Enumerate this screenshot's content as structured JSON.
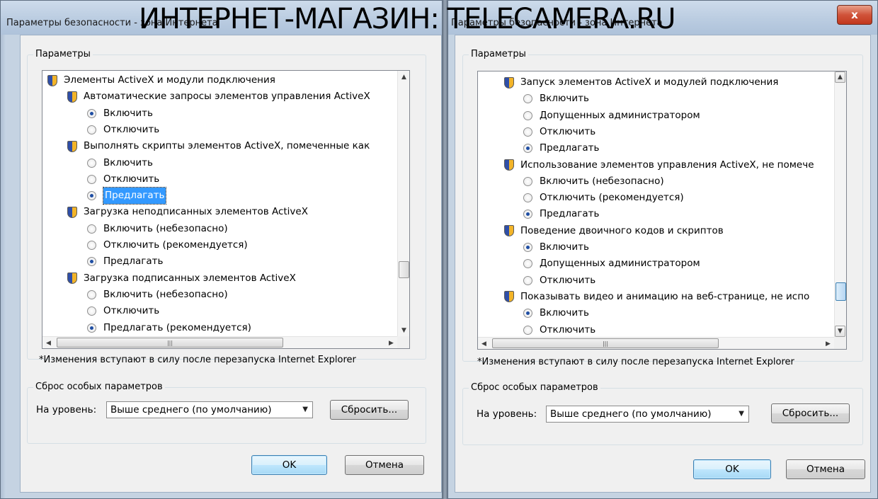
{
  "watermark": "ИНТЕРНЕТ-МАГАЗИН: TELECAMERA.RU",
  "left": {
    "title": "Параметры безопасности - зона Интернета",
    "group_params": "Параметры",
    "rows": [
      {
        "kind": "cat",
        "text": "Элементы ActiveX и модули подключения"
      },
      {
        "kind": "cat",
        "text": "Автоматические запросы элементов управления ActiveX"
      },
      {
        "kind": "radio",
        "on": true,
        "text": "Включить"
      },
      {
        "kind": "radio",
        "on": false,
        "text": "Отключить"
      },
      {
        "kind": "cat",
        "text": "Выполнять скрипты элементов ActiveX, помеченные как"
      },
      {
        "kind": "radio",
        "on": false,
        "text": "Включить"
      },
      {
        "kind": "radio",
        "on": false,
        "text": "Отключить"
      },
      {
        "kind": "radio",
        "on": true,
        "selected": true,
        "text": "Предлагать"
      },
      {
        "kind": "cat",
        "text": "Загрузка неподписанных элементов ActiveX"
      },
      {
        "kind": "radio",
        "on": false,
        "text": "Включить (небезопасно)"
      },
      {
        "kind": "radio",
        "on": false,
        "text": "Отключить (рекомендуется)"
      },
      {
        "kind": "radio",
        "on": true,
        "text": "Предлагать"
      },
      {
        "kind": "cat",
        "text": "Загрузка подписанных элементов ActiveX"
      },
      {
        "kind": "radio",
        "on": false,
        "text": "Включить (небезопасно)"
      },
      {
        "kind": "radio",
        "on": false,
        "text": "Отключить"
      },
      {
        "kind": "radio",
        "on": true,
        "text": "Предлагать (рекомендуется)"
      }
    ],
    "note": "*Изменения вступают в силу после перезапуска Internet Explorer",
    "group_reset": "Сброс особых параметров",
    "level_label": "На уровень:",
    "level_value": "Выше среднего (по умолчанию)",
    "reset_button": "Сбросить...",
    "ok": "OK",
    "cancel": "Отмена"
  },
  "right": {
    "title": "Параметры безопасности - зона Интернета",
    "close": "x",
    "group_params": "Параметры",
    "rows": [
      {
        "kind": "cat",
        "text": "Запуск элементов ActiveX и модулей подключения"
      },
      {
        "kind": "radio",
        "on": false,
        "text": "Включить"
      },
      {
        "kind": "radio",
        "on": false,
        "text": "Допущенных администратором"
      },
      {
        "kind": "radio",
        "on": false,
        "text": "Отключить"
      },
      {
        "kind": "radio",
        "on": true,
        "text": "Предлагать"
      },
      {
        "kind": "cat",
        "text": "Использование элементов управления ActiveX, не помече"
      },
      {
        "kind": "radio",
        "on": false,
        "text": "Включить (небезопасно)"
      },
      {
        "kind": "radio",
        "on": false,
        "text": "Отключить (рекомендуется)"
      },
      {
        "kind": "radio",
        "on": true,
        "text": "Предлагать"
      },
      {
        "kind": "cat",
        "text": "Поведение двоичного кодов и скриптов"
      },
      {
        "kind": "radio",
        "on": true,
        "text": "Включить"
      },
      {
        "kind": "radio",
        "on": false,
        "text": "Допущенных администратором"
      },
      {
        "kind": "radio",
        "on": false,
        "text": "Отключить"
      },
      {
        "kind": "cat",
        "text": "Показывать видео и анимацию на веб-странице, не испо"
      },
      {
        "kind": "radio",
        "on": true,
        "text": "Включить"
      },
      {
        "kind": "radio",
        "on": false,
        "text": "Отключить"
      }
    ],
    "note": "*Изменения вступают в силу после перезапуска Internet Explorer",
    "group_reset": "Сброс особых параметров",
    "level_label": "На уровень:",
    "level_value": "Выше среднего (по умолчанию)",
    "reset_button": "Сбросить...",
    "ok": "OK",
    "cancel": "Отмена"
  },
  "icons": {
    "category": "shield-icon",
    "close": "close-icon",
    "scroll_up": "triangle-up",
    "scroll_down": "triangle-down",
    "scroll_left": "triangle-left",
    "scroll_right": "triangle-right",
    "thumb_grip": "grip-lines"
  },
  "colors": {
    "selection": "#3399ff",
    "default_button_border": "#3c7fb1",
    "close_button": "#c2381d",
    "titlebar": "#b9cbe0",
    "dialog_face": "#f0f0f0"
  }
}
